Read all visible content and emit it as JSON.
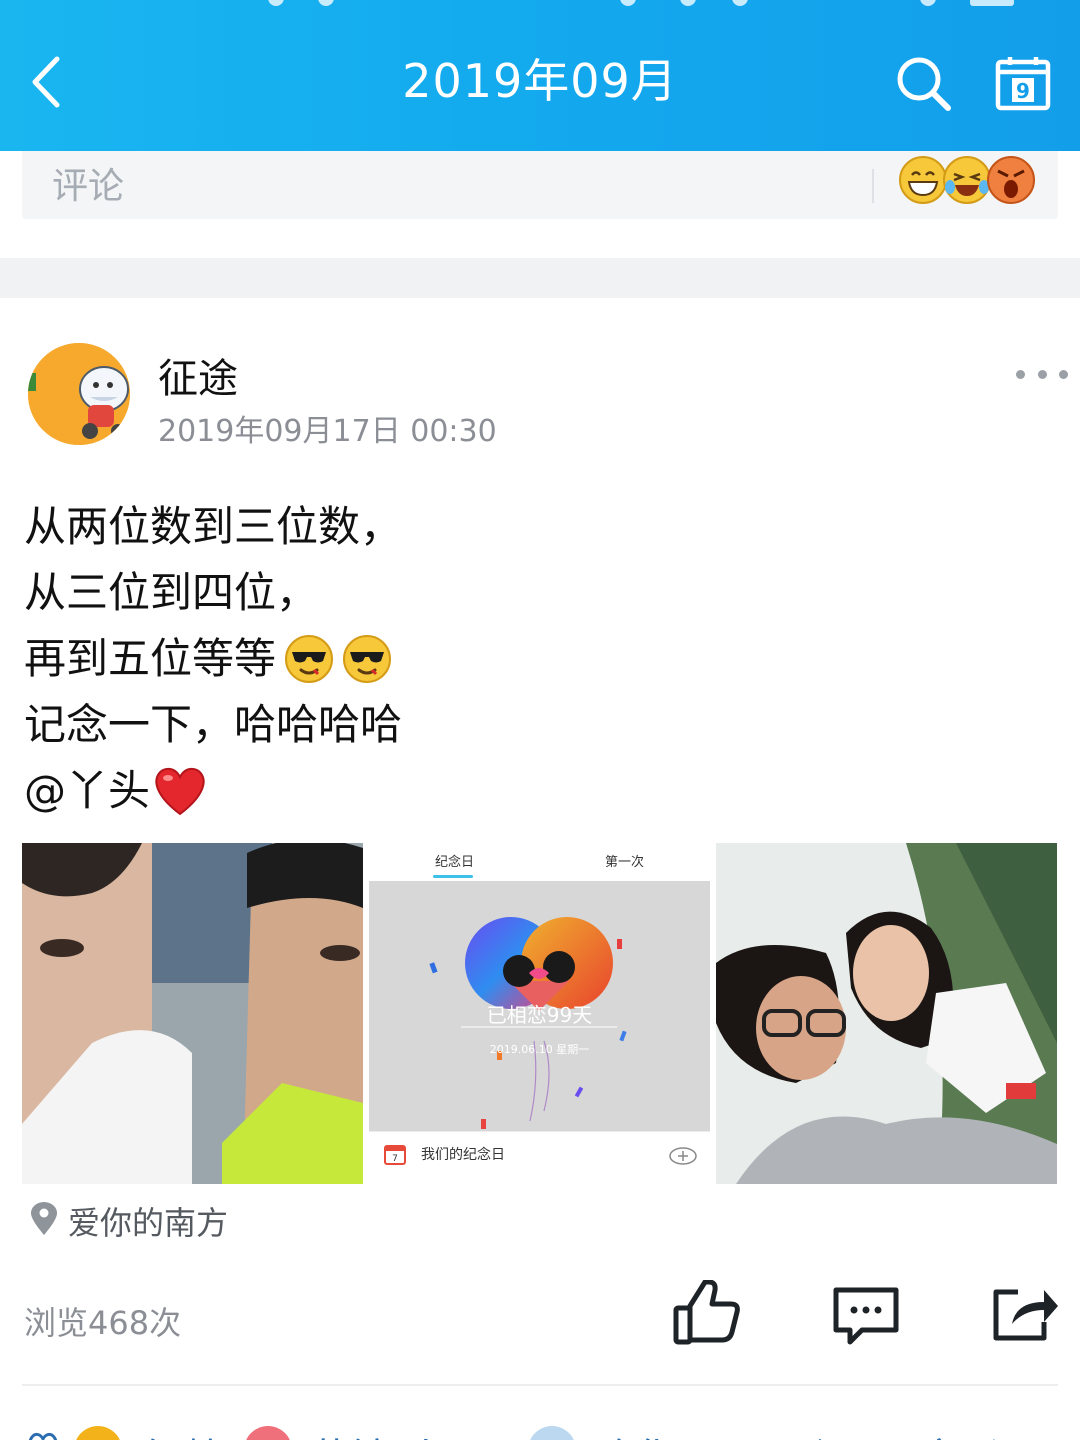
{
  "header": {
    "title": "2019年09月",
    "back_icon": "chevron-left-icon",
    "search_icon": "search-icon",
    "calendar_icon": "calendar-icon",
    "calendar_day": "9",
    "bar_color": "#13a8ee"
  },
  "comment_box": {
    "placeholder": "评论",
    "emoji_icons": [
      "grin-emoji-icon",
      "laugh-cry-emoji-icon",
      "angry-emoji-icon"
    ]
  },
  "post": {
    "author": "征途",
    "timestamp": "2019年09月17日 00:30",
    "text_lines": [
      "从两位数到三位数，",
      "从三位到四位，",
      "再到五位等等",
      "记念一下，哈哈哈哈",
      "@丫头"
    ],
    "line3_emojis": [
      "cool-sunglasses-emoji-icon",
      "cool-sunglasses-emoji-icon"
    ],
    "line5_emoji": "red-heart-emoji-icon",
    "photos": {
      "photo2": {
        "tab1": "纪念日",
        "tab2": "第一次",
        "headline": "已相恋99天",
        "date": "2019.06.10  星期一",
        "footer_label": "我们的纪念日"
      }
    },
    "location": "爱你的南方",
    "views": "浏览468次"
  },
  "actions": {
    "like_icon": "thumbs-up-icon",
    "comment_icon": "comment-icon",
    "share_icon": "share-icon"
  },
  "likes": {
    "names": [
      "红鹤",
      "藤镜(小)…",
      "路华里",
      "罗丽江",
      "石文影"
    ]
  }
}
